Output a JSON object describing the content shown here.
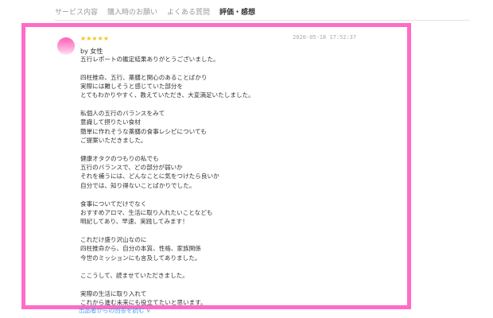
{
  "tabs": [
    {
      "label": "サービス内容",
      "active": false
    },
    {
      "label": "購入時のお願い",
      "active": false
    },
    {
      "label": "よくある質問",
      "active": false
    },
    {
      "label": "評価・感想",
      "active": true
    }
  ],
  "review": {
    "rating": 5,
    "stars": "★★★★★",
    "timestamp": "2020-05-18 17:52:37",
    "author": "by 女性",
    "lines": [
      "五行レポートの鑑定結果ありがとうございました。",
      "",
      "四柱推命、五行、薬膳と関心のあることばかり",
      "実際には難しそうと感じていた部分を",
      "とてもわかりやすく、教えていただき、大変満足いたしました。",
      "",
      "私個人の五行のバランスをみて",
      "意識して摂りたい食材",
      "簡単に作れそうな薬膳の食事レシピについても",
      "ご提案いただきました。",
      "",
      "健康オタクのつもりの私でも",
      "五行のバランスで、どの部分が弱いか",
      "それを補うには、どんなことに気をつけたら良いか",
      "自分では、知り得ないことばかりでした。",
      "",
      "食事についてだけでなく",
      "おすすめアロマ、生活に取り入れたいことなども",
      "明記してあり、早速、実践してみます！",
      "",
      "これだけ盛り沢山なのに",
      "四柱推命から、自分の本質、性格、家族関係",
      "今世のミッションにも言及してありました。",
      "",
      "ここうして、読ませていただきました。",
      "",
      "実際の生活に取り入れて",
      "これから進む未来にも役立てたいと思います。"
    ]
  },
  "more_link": "出品者からの回答を読む ∨",
  "colors": {
    "highlight_border": "#ff6bc8",
    "star": "#f2c51b",
    "link": "#4aa0e6"
  }
}
